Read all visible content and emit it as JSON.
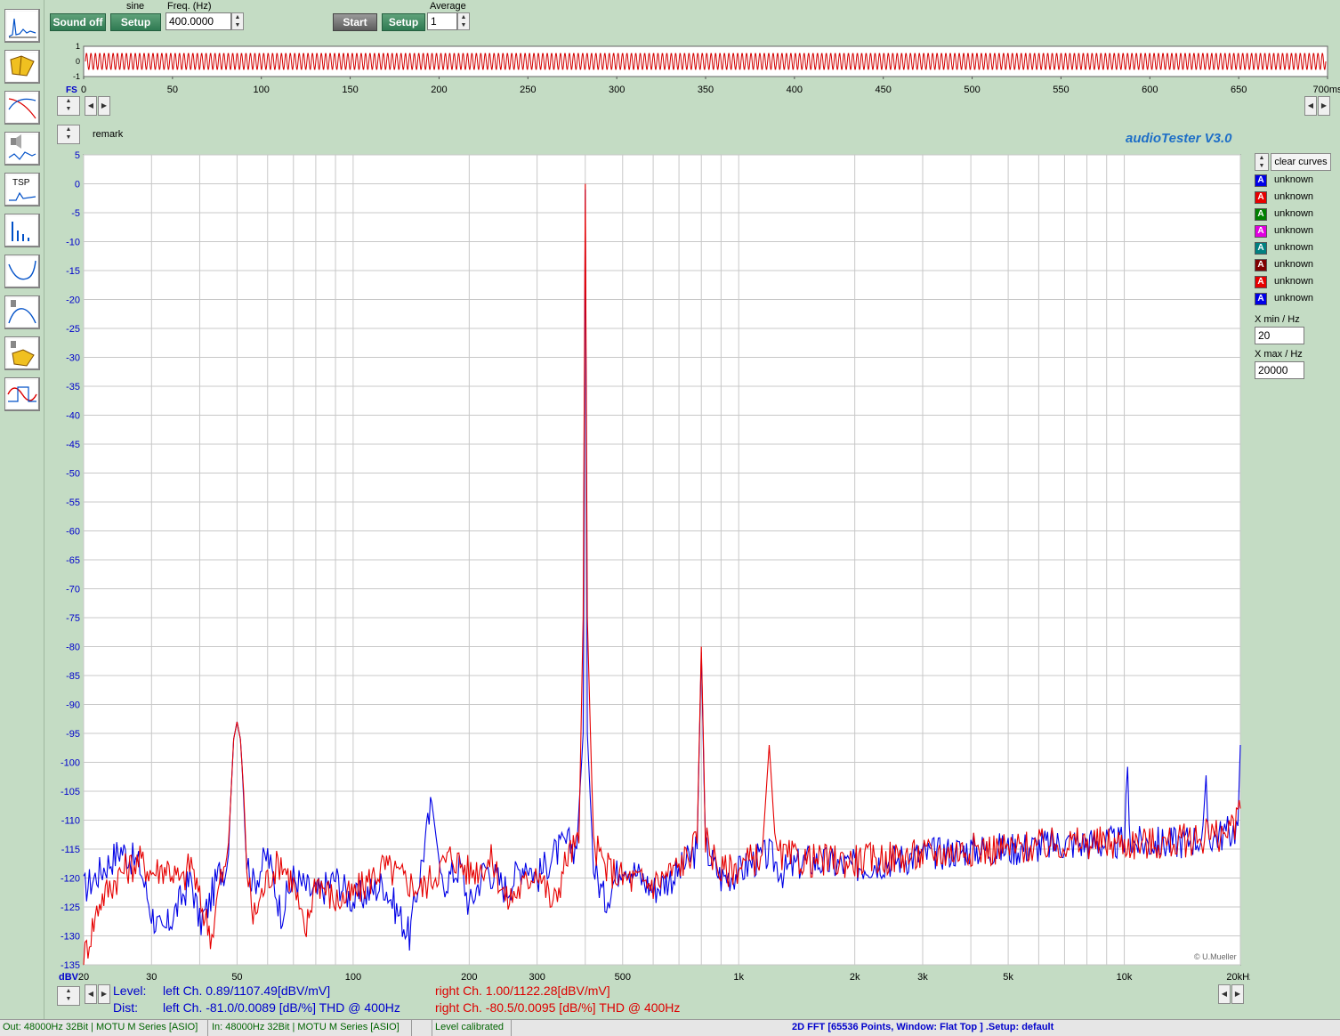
{
  "toolbar": {
    "sound_off": "Sound off",
    "signal_type": "sine",
    "setup1": "Setup",
    "freq_label": "Freq. (Hz)",
    "freq_value": "400.0000",
    "start": "Start",
    "setup2": "Setup",
    "average_label": "Average",
    "average_value": "1"
  },
  "sidebar": {
    "items": [
      {
        "name": "fft-analyzer",
        "text": ""
      },
      {
        "name": "sweep-book",
        "text": ""
      },
      {
        "name": "frequency-response",
        "text": ""
      },
      {
        "name": "speaker-impedance",
        "text": ""
      },
      {
        "name": "tsp-measurement",
        "text": "TSP"
      },
      {
        "name": "spectrum-bars",
        "text": ""
      },
      {
        "name": "impedance-curve",
        "text": ""
      },
      {
        "name": "speaker-response",
        "text": ""
      },
      {
        "name": "speaker-book",
        "text": ""
      },
      {
        "name": "oscilloscope",
        "text": ""
      }
    ]
  },
  "scope": {
    "y_ticks": [
      "1",
      "0",
      "-1"
    ],
    "fs_label": "FS",
    "x_ticks": [
      "0",
      "50",
      "100",
      "150",
      "200",
      "250",
      "300",
      "350",
      "400",
      "450",
      "500",
      "550",
      "600",
      "650",
      "700ms"
    ],
    "x_max_ms": 700,
    "signal_color": "#d40000"
  },
  "main": {
    "remark": "remark",
    "brand": "audioTester  V3.0",
    "copyright": "© U.Mueller",
    "y_unit": "dBV",
    "x_unit_last": "20kHz"
  },
  "legend": {
    "clear_curves": "clear curves",
    "items": [
      {
        "name": "unknown",
        "color": "#0000e6"
      },
      {
        "name": "unknown",
        "color": "#e60000"
      },
      {
        "name": "unknown",
        "color": "#008000"
      },
      {
        "name": "unknown",
        "color": "#e000e0"
      },
      {
        "name": "unknown",
        "color": "#008080"
      },
      {
        "name": "unknown",
        "color": "#800000"
      },
      {
        "name": "unknown",
        "color": "#e60000"
      },
      {
        "name": "unknown",
        "color": "#0000e6"
      }
    ],
    "swatch_letter": "A",
    "xmin_label": "X min / Hz",
    "xmin_value": "20",
    "xmax_label": "X max / Hz",
    "xmax_value": "20000"
  },
  "measurements": {
    "level_label": "Level:",
    "dist_label": "Dist:",
    "left_level": "left Ch. 0.89/1107.49[dBV/mV]",
    "left_dist": "left Ch. -81.0/0.0089 [dB/%] THD @ 400Hz",
    "right_level": "right Ch. 1.00/1122.28[dBV/mV]",
    "right_dist": "right Ch. -80.5/0.0095 [dB/%] THD @ 400Hz",
    "left_color": "#0000cc",
    "right_color": "#dd0000"
  },
  "status": {
    "out": "Out: 48000Hz 32Bit  | MOTU M Series [ASIO]",
    "in": "In: 48000Hz 32Bit  | MOTU M Series [ASIO]",
    "calib": "Level calibrated",
    "fft": "2D FFT [65536 Points, Window: Flat Top ]  .Setup:  default"
  },
  "chart_data": {
    "type": "line",
    "title": "",
    "xlabel": "",
    "ylabel": "dBV",
    "x_scale": "log",
    "xlim": [
      20,
      20000
    ],
    "ylim": [
      -135,
      5
    ],
    "grid": true,
    "x_tick_labels": [
      "20",
      "30",
      "50",
      "100",
      "200",
      "300",
      "500",
      "1k",
      "2k",
      "3k",
      "5k",
      "10k",
      "20kHz"
    ],
    "x_tick_values": [
      20,
      30,
      50,
      100,
      200,
      300,
      500,
      1000,
      2000,
      3000,
      5000,
      10000,
      20000
    ],
    "y_ticks": [
      5,
      0,
      -5,
      -10,
      -15,
      -20,
      -25,
      -30,
      -35,
      -40,
      -45,
      -50,
      -55,
      -60,
      -65,
      -70,
      -75,
      -80,
      -85,
      -90,
      -95,
      -100,
      -105,
      -110,
      -115,
      -120,
      -125,
      -130,
      -135
    ],
    "series": [
      {
        "color": "#0000e6",
        "points": [
          [
            20,
            -122
          ],
          [
            22,
            -119
          ],
          [
            25,
            -115
          ],
          [
            28,
            -118
          ],
          [
            30,
            -126
          ],
          [
            32,
            -130
          ],
          [
            35,
            -125
          ],
          [
            38,
            -120
          ],
          [
            40,
            -128
          ],
          [
            42,
            -125
          ],
          [
            45,
            -119
          ],
          [
            47,
            -118
          ],
          [
            48,
            -108
          ],
          [
            49,
            -96
          ],
          [
            50,
            -93
          ],
          [
            51,
            -96
          ],
          [
            52,
            -105
          ],
          [
            53,
            -117
          ],
          [
            55,
            -121
          ],
          [
            60,
            -116
          ],
          [
            65,
            -126
          ],
          [
            70,
            -120
          ],
          [
            80,
            -123
          ],
          [
            90,
            -120
          ],
          [
            100,
            -124
          ],
          [
            120,
            -121
          ],
          [
            140,
            -130
          ],
          [
            150,
            -118
          ],
          [
            160,
            -107
          ],
          [
            170,
            -121
          ],
          [
            190,
            -118
          ],
          [
            200,
            -125
          ],
          [
            220,
            -118
          ],
          [
            250,
            -122
          ],
          [
            280,
            -117
          ],
          [
            300,
            -120
          ],
          [
            330,
            -116
          ],
          [
            360,
            -114
          ],
          [
            380,
            -115
          ],
          [
            395,
            -95
          ],
          [
            400,
            -1
          ],
          [
            405,
            -95
          ],
          [
            420,
            -118
          ],
          [
            450,
            -124
          ],
          [
            500,
            -117
          ],
          [
            600,
            -122
          ],
          [
            700,
            -119
          ],
          [
            780,
            -115
          ],
          [
            800,
            -81
          ],
          [
            820,
            -115
          ],
          [
            900,
            -120
          ],
          [
            1000,
            -119
          ],
          [
            1100,
            -117
          ],
          [
            1200,
            -116
          ],
          [
            1300,
            -119
          ],
          [
            1500,
            -117
          ],
          [
            2000,
            -118
          ],
          [
            3000,
            -116
          ],
          [
            4000,
            -115
          ],
          [
            5000,
            -115
          ],
          [
            7000,
            -114
          ],
          [
            9000,
            -114
          ],
          [
            10000,
            -114
          ],
          [
            10200,
            -102
          ],
          [
            10400,
            -114
          ],
          [
            13000,
            -114
          ],
          [
            16000,
            -113
          ],
          [
            16300,
            -105
          ],
          [
            16600,
            -113
          ],
          [
            19000,
            -112
          ],
          [
            19700,
            -111
          ],
          [
            20000,
            -97
          ]
        ]
      },
      {
        "color": "#e60000",
        "points": [
          [
            20,
            -134
          ],
          [
            22,
            -124
          ],
          [
            25,
            -119
          ],
          [
            28,
            -117
          ],
          [
            30,
            -119
          ],
          [
            33,
            -118
          ],
          [
            36,
            -121
          ],
          [
            38,
            -117
          ],
          [
            40,
            -124
          ],
          [
            43,
            -130
          ],
          [
            45,
            -121
          ],
          [
            47,
            -118
          ],
          [
            48,
            -108
          ],
          [
            49,
            -96
          ],
          [
            50,
            -93
          ],
          [
            51,
            -96
          ],
          [
            52,
            -105
          ],
          [
            53,
            -118
          ],
          [
            55,
            -127
          ],
          [
            60,
            -120
          ],
          [
            65,
            -117
          ],
          [
            70,
            -121
          ],
          [
            75,
            -130
          ],
          [
            80,
            -120
          ],
          [
            90,
            -124
          ],
          [
            100,
            -123
          ],
          [
            120,
            -118
          ],
          [
            150,
            -122
          ],
          [
            180,
            -116
          ],
          [
            200,
            -119
          ],
          [
            230,
            -117
          ],
          [
            250,
            -124
          ],
          [
            280,
            -121
          ],
          [
            300,
            -118
          ],
          [
            330,
            -125
          ],
          [
            360,
            -116
          ],
          [
            385,
            -114
          ],
          [
            395,
            -75
          ],
          [
            400,
            0
          ],
          [
            405,
            -75
          ],
          [
            420,
            -114
          ],
          [
            450,
            -118
          ],
          [
            500,
            -120
          ],
          [
            600,
            -121
          ],
          [
            700,
            -118
          ],
          [
            780,
            -114
          ],
          [
            800,
            -80
          ],
          [
            820,
            -113
          ],
          [
            900,
            -119
          ],
          [
            1000,
            -118
          ],
          [
            1150,
            -116
          ],
          [
            1200,
            -97
          ],
          [
            1250,
            -116
          ],
          [
            1500,
            -117
          ],
          [
            2000,
            -117
          ],
          [
            3000,
            -116
          ],
          [
            4000,
            -115
          ],
          [
            5000,
            -115
          ],
          [
            7000,
            -114
          ],
          [
            10000,
            -114
          ],
          [
            13000,
            -114
          ],
          [
            16000,
            -113
          ],
          [
            16300,
            -110
          ],
          [
            16600,
            -113
          ],
          [
            19000,
            -112
          ],
          [
            19700,
            -109
          ],
          [
            20000,
            -108
          ]
        ]
      }
    ]
  }
}
